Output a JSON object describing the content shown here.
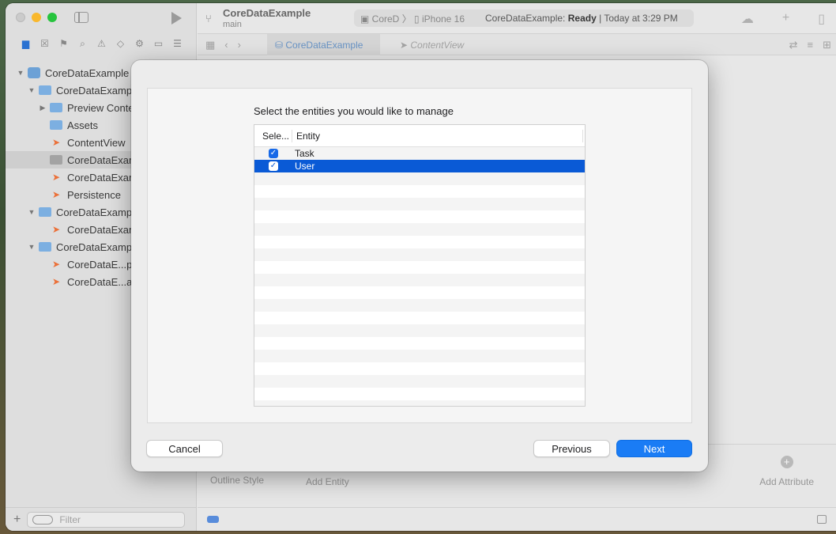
{
  "window": {
    "project_name": "CoreDataExample",
    "branch": "main",
    "destination_scheme": "CoreD",
    "destination_device": "iPhone 16",
    "status_project": "CoreDataExample:",
    "status_state": "Ready",
    "status_time": "| Today at 3:29 PM"
  },
  "tabs": {
    "active": "CoreDataExample",
    "inactive": "ContentView"
  },
  "sidebar": {
    "items": [
      {
        "label": "CoreDataExample",
        "icon": "app",
        "indent": 0,
        "disclosure": "open"
      },
      {
        "label": "CoreDataExamp",
        "icon": "folder",
        "indent": 1,
        "disclosure": "open"
      },
      {
        "label": "Preview Conte",
        "icon": "folder",
        "indent": 2,
        "disclosure": "closed"
      },
      {
        "label": "Assets",
        "icon": "assets",
        "indent": 2,
        "disclosure": "none"
      },
      {
        "label": "ContentView",
        "icon": "swift",
        "indent": 2,
        "disclosure": "none"
      },
      {
        "label": "CoreDataExam",
        "icon": "model",
        "indent": 2,
        "disclosure": "none",
        "selected": true
      },
      {
        "label": "CoreDataExam",
        "icon": "swift",
        "indent": 2,
        "disclosure": "none"
      },
      {
        "label": "Persistence",
        "icon": "swift",
        "indent": 2,
        "disclosure": "none"
      },
      {
        "label": "CoreDataExamp",
        "icon": "folder",
        "indent": 1,
        "disclosure": "open"
      },
      {
        "label": "CoreDataExam",
        "icon": "swift",
        "indent": 2,
        "disclosure": "none"
      },
      {
        "label": "CoreDataExamp",
        "icon": "folder",
        "indent": 1,
        "disclosure": "open"
      },
      {
        "label": "CoreDataE...p",
        "icon": "swift",
        "indent": 2,
        "disclosure": "none"
      },
      {
        "label": "CoreDataE...a",
        "icon": "swift",
        "indent": 2,
        "disclosure": "none"
      }
    ],
    "filter_placeholder": "Filter"
  },
  "editor_footer": {
    "outline_style": "Outline Style",
    "add_entity": "Add Entity",
    "add_attribute": "Add Attribute"
  },
  "dialog": {
    "prompt": "Select the entities you would like to manage",
    "columns": {
      "select": "Sele...",
      "entity": "Entity"
    },
    "rows": [
      {
        "entity": "Task",
        "checked": true,
        "selected": false
      },
      {
        "entity": "User",
        "checked": true,
        "selected": true
      }
    ],
    "empty_rows": 19,
    "buttons": {
      "cancel": "Cancel",
      "previous": "Previous",
      "next": "Next"
    }
  },
  "colors": {
    "accent": "#1a7cf5",
    "selection": "#0a5ad6"
  }
}
